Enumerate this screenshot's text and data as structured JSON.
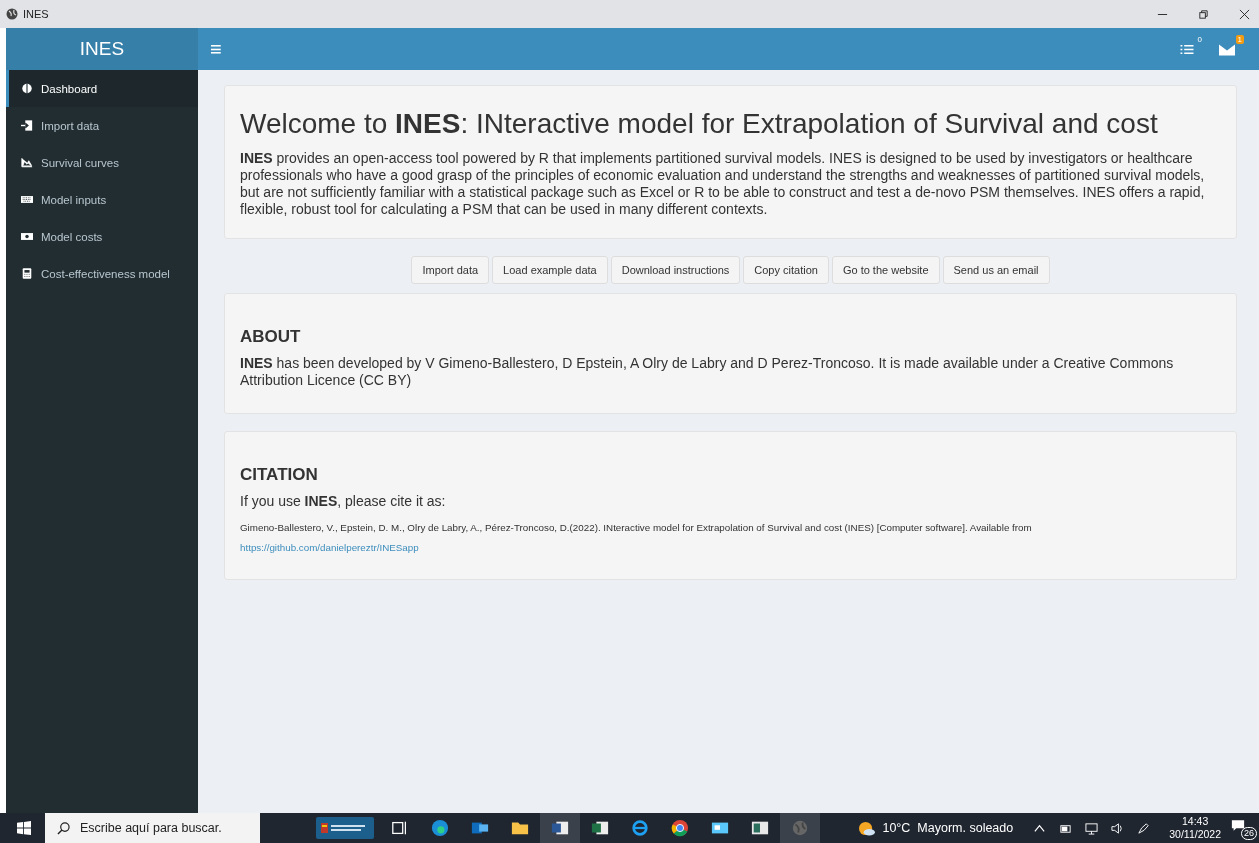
{
  "window": {
    "title": "INES"
  },
  "header": {
    "brand": "INES",
    "menu_glyph": "≡",
    "tasks_badge": "0",
    "messages_badge": "1"
  },
  "sidebar": {
    "items": [
      {
        "label": "Dashboard",
        "selected": true
      },
      {
        "label": "Import data",
        "selected": false
      },
      {
        "label": "Survival curves",
        "selected": false
      },
      {
        "label": "Model inputs",
        "selected": false
      },
      {
        "label": "Model costs",
        "selected": false
      },
      {
        "label": "Cost-effectiveness model",
        "selected": false
      }
    ]
  },
  "welcome": {
    "title": "Welcome to **INES**: INteractive model for Extrapolation of Survival and cost",
    "text": "**INES** provides an open-access tool powered by R that implements partitioned survival models. INES is designed to be used by investigators or healthcare professionals who have a good grasp of the principles of economic evaluation and understand the strengths and weaknesses of partitioned survival models, but are not sufficiently familiar with a statistical package such as Excel or R to be able to construct and test a de-novo PSM themselves. INES offers a rapid, flexible, robust tool for calculating a PSM that can be used in many different contexts."
  },
  "buttons": [
    "Import data",
    "Load example data",
    "Download instructions",
    "Copy citation",
    "Go to the website",
    "Send us an email"
  ],
  "about": {
    "heading": "ABOUT",
    "text": "**INES** has been developed by V Gimeno-Ballestero, D Epstein, A Olry de Labry and D Perez-Troncoso. It is made available under a Creative Commons Attribution Licence (CC BY)"
  },
  "citation": {
    "heading": "CITATION",
    "intro": "If you use **INES**, please cite it as:",
    "reference": "Gimeno-Ballestero, V., Epstein, D. M., Olry de Labry, A., Pérez-Troncoso, D.(2022). INteractive model for Extrapolation of Survival and cost (INES) [Computer software]. Available from",
    "link": "https://github.com/danielpereztr/INESapp"
  },
  "taskbar": {
    "search_placeholder": "Escribe aquí para buscar.",
    "weather": "10°C  Mayorm. soleado",
    "time": "14:43",
    "date": "30/11/2022",
    "notifications": "26"
  }
}
